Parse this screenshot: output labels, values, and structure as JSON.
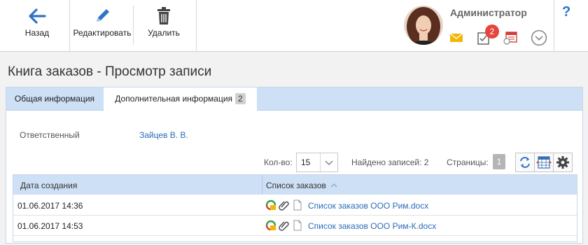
{
  "toolbar": {
    "back_label": "Назад",
    "edit_label": "Редактировать",
    "delete_label": "Удалить"
  },
  "user": {
    "name": "Администратор",
    "notifications_count": "2",
    "help": "?"
  },
  "page_title": "Книга заказов - Просмотр записи",
  "tabs": [
    {
      "label": "Общая информация",
      "active": false
    },
    {
      "label": "Дополнительная информация",
      "count": "2",
      "active": true
    }
  ],
  "fields": {
    "responsible_label": "Ответственный",
    "responsible_value": "Зайцев В. В."
  },
  "list_controls": {
    "qty_label": "Кол-во:",
    "qty_value": "15",
    "found_label": "Найдено записей: 2",
    "pages_label": "Страницы:",
    "page_current": "1"
  },
  "grid": {
    "columns": [
      "Дата создания",
      "Список заказов"
    ],
    "rows": [
      {
        "created": "01.06.2017 14:36",
        "file": "Список заказов ООО Рим.docx"
      },
      {
        "created": "01.06.2017 14:53",
        "file": "Список заказов ООО Рим-К.docx"
      }
    ]
  },
  "colors": {
    "accent_blue": "#2e73c8",
    "tab_bar": "#cde0f5",
    "badge_red": "#e5453c",
    "mail_yellow": "#f2b705"
  },
  "icons": [
    "back-arrow-icon",
    "pencil-icon",
    "trash-icon",
    "mail-icon",
    "tasks-icon",
    "calendar-icon",
    "chevron-down-icon",
    "refresh-icon",
    "columns-icon",
    "gear-icon",
    "sort-arrow-icon",
    "status-icon",
    "paperclip-icon",
    "document-icon"
  ]
}
